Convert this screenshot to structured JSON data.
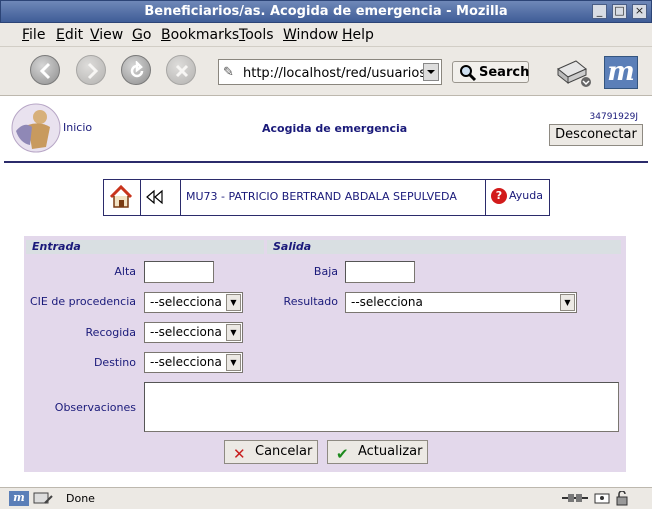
{
  "window": {
    "title": "Beneficiarios/as. Acogida de emergencia - Mozilla"
  },
  "menu": [
    "File",
    "Edit",
    "View",
    "Go",
    "Bookmarks",
    "Tools",
    "Window",
    "Help"
  ],
  "menu_mnemonics": [
    "F",
    "E",
    "V",
    "G",
    "B",
    "T",
    "W",
    "H"
  ],
  "toolbar": {
    "url": "http://localhost/red/usuarios/mo",
    "search_label": "Search"
  },
  "header": {
    "inicio": "Inicio",
    "page_title": "Acogida de emergencia",
    "user_id": "34791929J",
    "disconnect": "Desconectar"
  },
  "nav": {
    "patient": "MU73 - PATRICIO BERTRAND ABDALA SEPULVEDA",
    "help": "Ayuda"
  },
  "form": {
    "entrada_title": "Entrada",
    "salida_title": "Salida",
    "alta_label": "Alta",
    "alta_value": "",
    "baja_label": "Baja",
    "baja_value": "",
    "cie_label": "CIE de procedencia",
    "cie_value": "--selecciona",
    "resultado_label": "Resultado",
    "resultado_value": "--selecciona",
    "recogida_label": "Recogida",
    "recogida_value": "--selecciona",
    "destino_label": "Destino",
    "destino_value": "--selecciona",
    "observaciones_label": "Observaciones",
    "observaciones_value": "",
    "cancel_label": "Cancelar",
    "update_label": "Actualizar"
  },
  "status": {
    "text": "Done"
  },
  "colors": {
    "panel_bg": "#e3d8eb",
    "section_header_bg": "#d9dfe2",
    "text_navy": "#1a1a7a",
    "cancel_icon": "#c81e1e",
    "update_icon": "#1e8a1e"
  }
}
